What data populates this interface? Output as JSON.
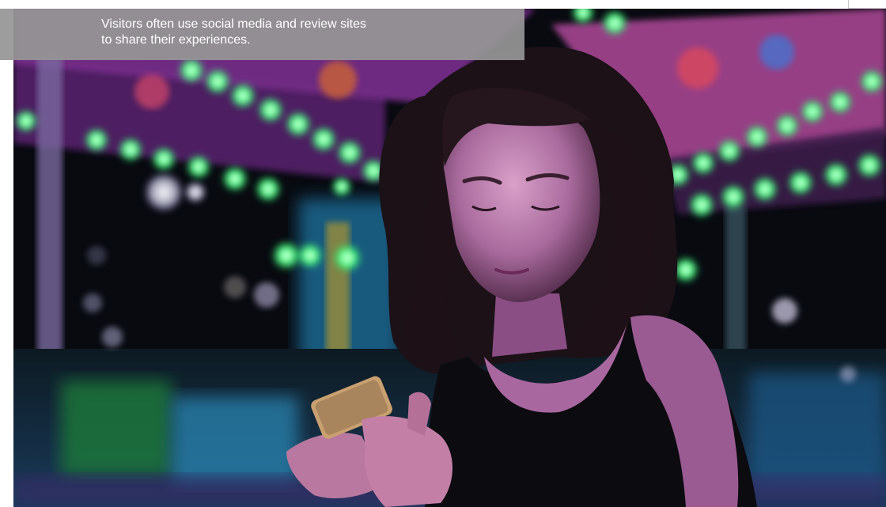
{
  "caption": {
    "text": "Visitors often use social media and review sites\nto share their experiences."
  },
  "photo": {
    "subject": "woman-looking-at-phone-at-night-carnival",
    "colors": {
      "night_bg": "#0a0c12",
      "green_light": "#3cff7a",
      "neon_pink": "#d246b4",
      "carousel_purple": "#6a2a8a",
      "cyan_blue": "#2aa4d6",
      "skin_lit": "#c98cc4",
      "hair": "#1a1014"
    }
  }
}
